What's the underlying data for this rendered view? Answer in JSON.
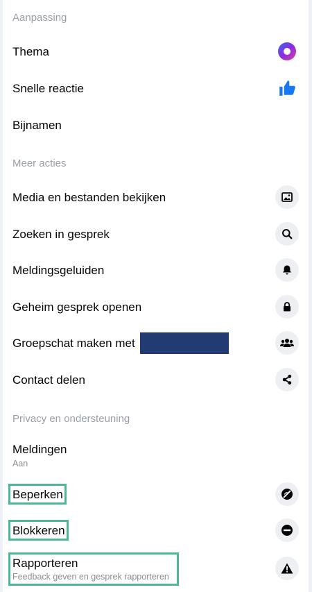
{
  "sections": {
    "customization": "Aanpassing",
    "more_actions": "Meer acties",
    "privacy": "Privacy en ondersteuning"
  },
  "customization": {
    "theme": "Thema",
    "quick_reaction": "Snelle reactie",
    "nicknames": "Bijnamen"
  },
  "actions": {
    "media": "Media en bestanden bekijken",
    "search": "Zoeken in gesprek",
    "sounds": "Meldingsgeluiden",
    "secret": "Geheim gesprek openen",
    "group": "Groepschat maken met",
    "share": "Contact delen"
  },
  "privacy": {
    "notifications": "Meldingen",
    "notifications_status": "Aan",
    "restrict": "Beperken",
    "block": "Blokkeren",
    "report": "Rapporteren",
    "report_sub": "Feedback geven en gesprek rapporteren"
  },
  "colors": {
    "theme_accent": "#7b3cf0",
    "like_blue": "#1877f2",
    "highlight": "#4db797",
    "redaction": "#233b73"
  }
}
